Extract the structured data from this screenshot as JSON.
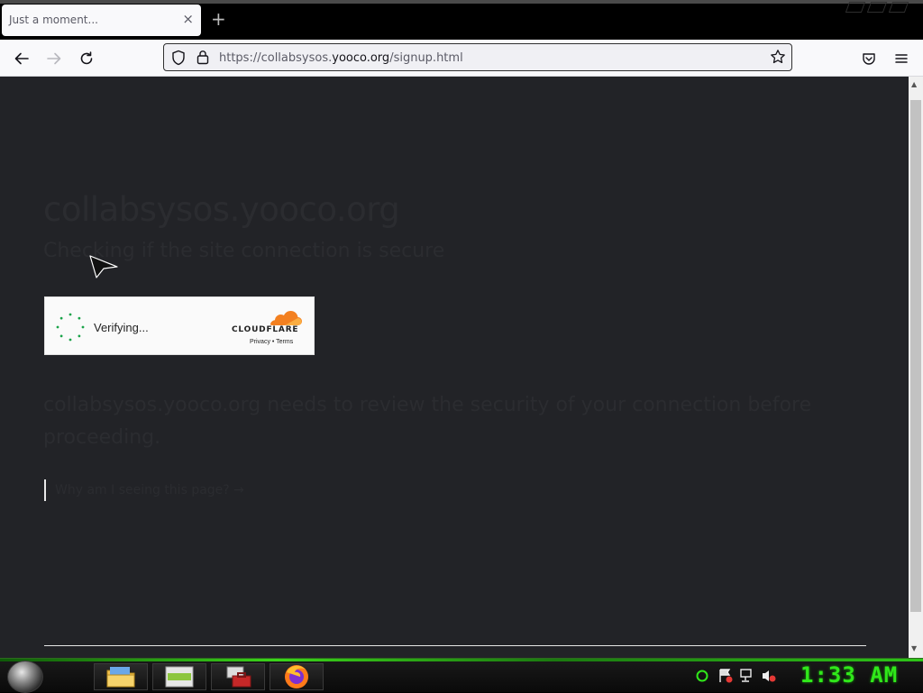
{
  "tab": {
    "title": "Just a moment...",
    "close_glyph": "×",
    "new_tab_glyph": "+"
  },
  "nav": {
    "back_icon": "arrow-left-icon",
    "forward_icon": "arrow-right-icon",
    "reload_icon": "reload-icon",
    "url_prefix": "https://collabsysos.",
    "url_host": "yooco.org",
    "url_path": "/signup.html"
  },
  "page": {
    "site_title": "collabsysos.yooco.org",
    "subtitle": "Checking if the site connection is secure",
    "widget": {
      "status": "Verifying...",
      "brand": "CLOUDFLARE",
      "links": "Privacy • Terms"
    },
    "review_text": "collabsysos.yooco.org needs to review the security of your connection before proceeding.",
    "why_link": "Why am I seeing this page? →"
  },
  "taskbar": {
    "clock": "1:33 AM",
    "accent": "#30e81a"
  },
  "colors": {
    "page_bg": "#222327",
    "cloudflare_orange": "#f38020"
  }
}
